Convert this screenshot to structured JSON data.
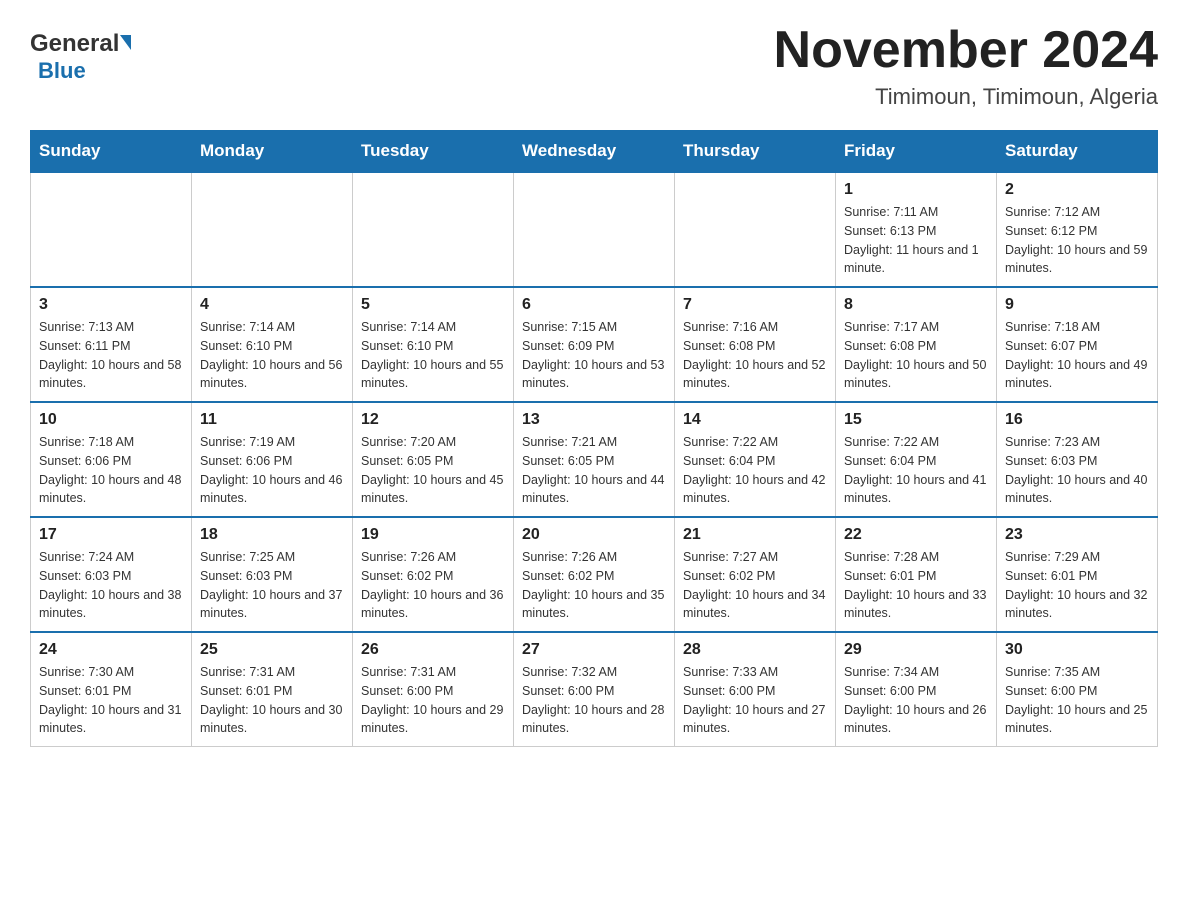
{
  "header": {
    "logo_general": "General",
    "logo_blue": "Blue",
    "title": "November 2024",
    "subtitle": "Timimoun, Timimoun, Algeria"
  },
  "days_of_week": [
    "Sunday",
    "Monday",
    "Tuesday",
    "Wednesday",
    "Thursday",
    "Friday",
    "Saturday"
  ],
  "weeks": [
    {
      "days": [
        {
          "num": "",
          "info": ""
        },
        {
          "num": "",
          "info": ""
        },
        {
          "num": "",
          "info": ""
        },
        {
          "num": "",
          "info": ""
        },
        {
          "num": "",
          "info": ""
        },
        {
          "num": "1",
          "info": "Sunrise: 7:11 AM\nSunset: 6:13 PM\nDaylight: 11 hours and 1 minute."
        },
        {
          "num": "2",
          "info": "Sunrise: 7:12 AM\nSunset: 6:12 PM\nDaylight: 10 hours and 59 minutes."
        }
      ]
    },
    {
      "days": [
        {
          "num": "3",
          "info": "Sunrise: 7:13 AM\nSunset: 6:11 PM\nDaylight: 10 hours and 58 minutes."
        },
        {
          "num": "4",
          "info": "Sunrise: 7:14 AM\nSunset: 6:10 PM\nDaylight: 10 hours and 56 minutes."
        },
        {
          "num": "5",
          "info": "Sunrise: 7:14 AM\nSunset: 6:10 PM\nDaylight: 10 hours and 55 minutes."
        },
        {
          "num": "6",
          "info": "Sunrise: 7:15 AM\nSunset: 6:09 PM\nDaylight: 10 hours and 53 minutes."
        },
        {
          "num": "7",
          "info": "Sunrise: 7:16 AM\nSunset: 6:08 PM\nDaylight: 10 hours and 52 minutes."
        },
        {
          "num": "8",
          "info": "Sunrise: 7:17 AM\nSunset: 6:08 PM\nDaylight: 10 hours and 50 minutes."
        },
        {
          "num": "9",
          "info": "Sunrise: 7:18 AM\nSunset: 6:07 PM\nDaylight: 10 hours and 49 minutes."
        }
      ]
    },
    {
      "days": [
        {
          "num": "10",
          "info": "Sunrise: 7:18 AM\nSunset: 6:06 PM\nDaylight: 10 hours and 48 minutes."
        },
        {
          "num": "11",
          "info": "Sunrise: 7:19 AM\nSunset: 6:06 PM\nDaylight: 10 hours and 46 minutes."
        },
        {
          "num": "12",
          "info": "Sunrise: 7:20 AM\nSunset: 6:05 PM\nDaylight: 10 hours and 45 minutes."
        },
        {
          "num": "13",
          "info": "Sunrise: 7:21 AM\nSunset: 6:05 PM\nDaylight: 10 hours and 44 minutes."
        },
        {
          "num": "14",
          "info": "Sunrise: 7:22 AM\nSunset: 6:04 PM\nDaylight: 10 hours and 42 minutes."
        },
        {
          "num": "15",
          "info": "Sunrise: 7:22 AM\nSunset: 6:04 PM\nDaylight: 10 hours and 41 minutes."
        },
        {
          "num": "16",
          "info": "Sunrise: 7:23 AM\nSunset: 6:03 PM\nDaylight: 10 hours and 40 minutes."
        }
      ]
    },
    {
      "days": [
        {
          "num": "17",
          "info": "Sunrise: 7:24 AM\nSunset: 6:03 PM\nDaylight: 10 hours and 38 minutes."
        },
        {
          "num": "18",
          "info": "Sunrise: 7:25 AM\nSunset: 6:03 PM\nDaylight: 10 hours and 37 minutes."
        },
        {
          "num": "19",
          "info": "Sunrise: 7:26 AM\nSunset: 6:02 PM\nDaylight: 10 hours and 36 minutes."
        },
        {
          "num": "20",
          "info": "Sunrise: 7:26 AM\nSunset: 6:02 PM\nDaylight: 10 hours and 35 minutes."
        },
        {
          "num": "21",
          "info": "Sunrise: 7:27 AM\nSunset: 6:02 PM\nDaylight: 10 hours and 34 minutes."
        },
        {
          "num": "22",
          "info": "Sunrise: 7:28 AM\nSunset: 6:01 PM\nDaylight: 10 hours and 33 minutes."
        },
        {
          "num": "23",
          "info": "Sunrise: 7:29 AM\nSunset: 6:01 PM\nDaylight: 10 hours and 32 minutes."
        }
      ]
    },
    {
      "days": [
        {
          "num": "24",
          "info": "Sunrise: 7:30 AM\nSunset: 6:01 PM\nDaylight: 10 hours and 31 minutes."
        },
        {
          "num": "25",
          "info": "Sunrise: 7:31 AM\nSunset: 6:01 PM\nDaylight: 10 hours and 30 minutes."
        },
        {
          "num": "26",
          "info": "Sunrise: 7:31 AM\nSunset: 6:00 PM\nDaylight: 10 hours and 29 minutes."
        },
        {
          "num": "27",
          "info": "Sunrise: 7:32 AM\nSunset: 6:00 PM\nDaylight: 10 hours and 28 minutes."
        },
        {
          "num": "28",
          "info": "Sunrise: 7:33 AM\nSunset: 6:00 PM\nDaylight: 10 hours and 27 minutes."
        },
        {
          "num": "29",
          "info": "Sunrise: 7:34 AM\nSunset: 6:00 PM\nDaylight: 10 hours and 26 minutes."
        },
        {
          "num": "30",
          "info": "Sunrise: 7:35 AM\nSunset: 6:00 PM\nDaylight: 10 hours and 25 minutes."
        }
      ]
    }
  ]
}
